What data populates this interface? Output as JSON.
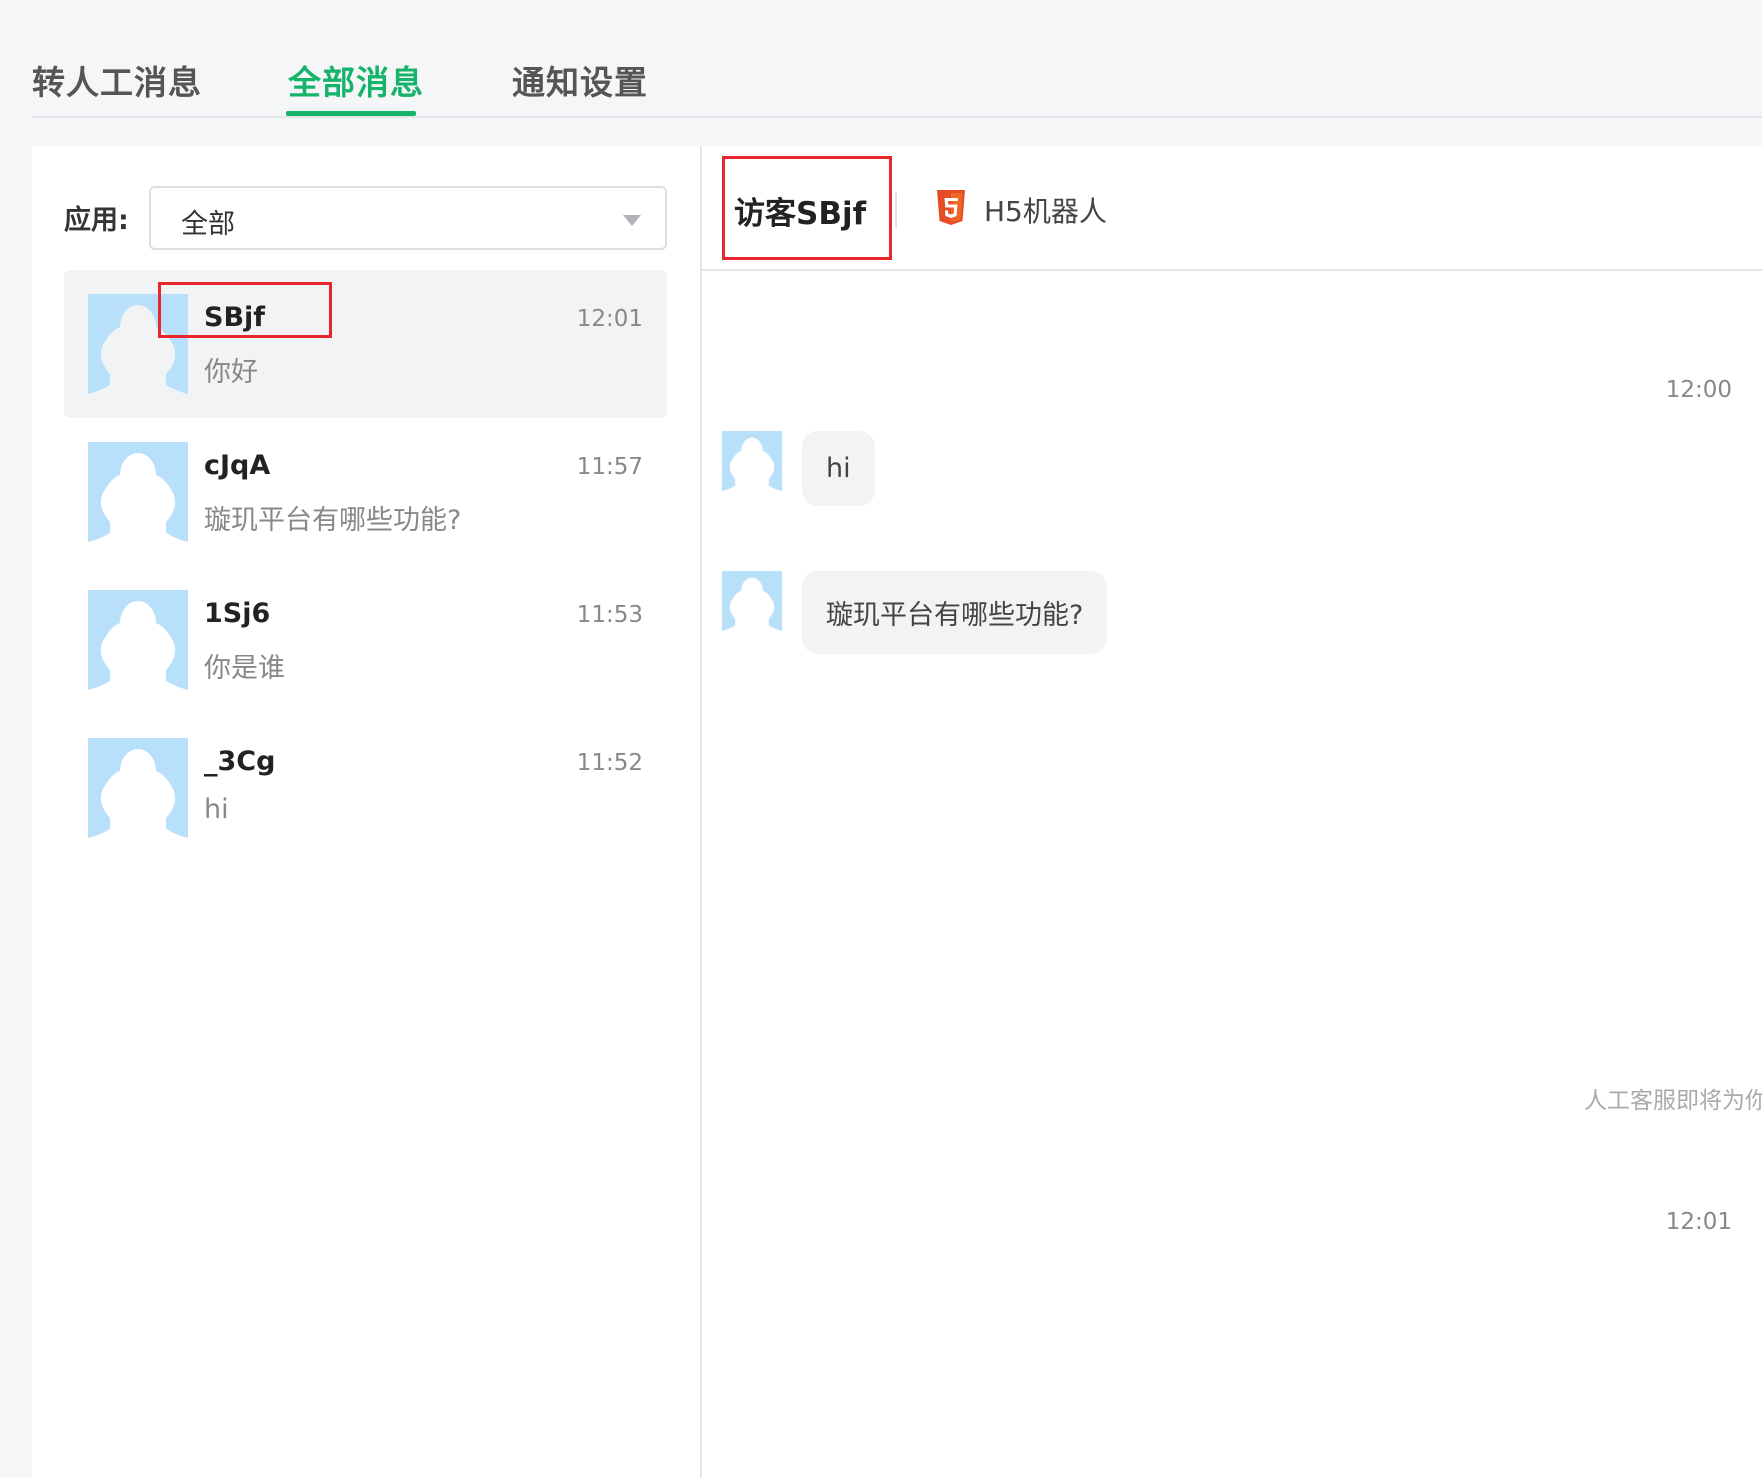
{
  "tabs": [
    {
      "label": "转人工消息",
      "active": false
    },
    {
      "label": "全部消息",
      "active": true
    },
    {
      "label": "通知设置",
      "active": false
    }
  ],
  "colors": {
    "accent": "#16b36a",
    "highlight": "#e8262c",
    "avatar": "#b8e0fb"
  },
  "filter": {
    "label": "应用:",
    "value": "全部",
    "icon": "caret-down-icon"
  },
  "conversations": [
    {
      "name": "SBjf",
      "time": "12:01",
      "preview": "你好",
      "active": true
    },
    {
      "name": "cJqA",
      "time": "11:57",
      "preview": "璇玑平台有哪些功能?",
      "active": false
    },
    {
      "name": "1Sj6",
      "time": "11:53",
      "preview": "你是谁",
      "active": false
    },
    {
      "name": "_3Cg",
      "time": "11:52",
      "preview": "hi",
      "active": false
    }
  ],
  "chat": {
    "visitor_name": "访客SBjf",
    "app_icon": "html5-icon",
    "app_name": "H5机器人",
    "messages": [
      {
        "time": "12:00"
      },
      {
        "text": "hi"
      },
      {
        "text": "璇玑平台有哪些功能?"
      }
    ],
    "system_note": "人工客服即将为你",
    "last_time": "12:01"
  }
}
